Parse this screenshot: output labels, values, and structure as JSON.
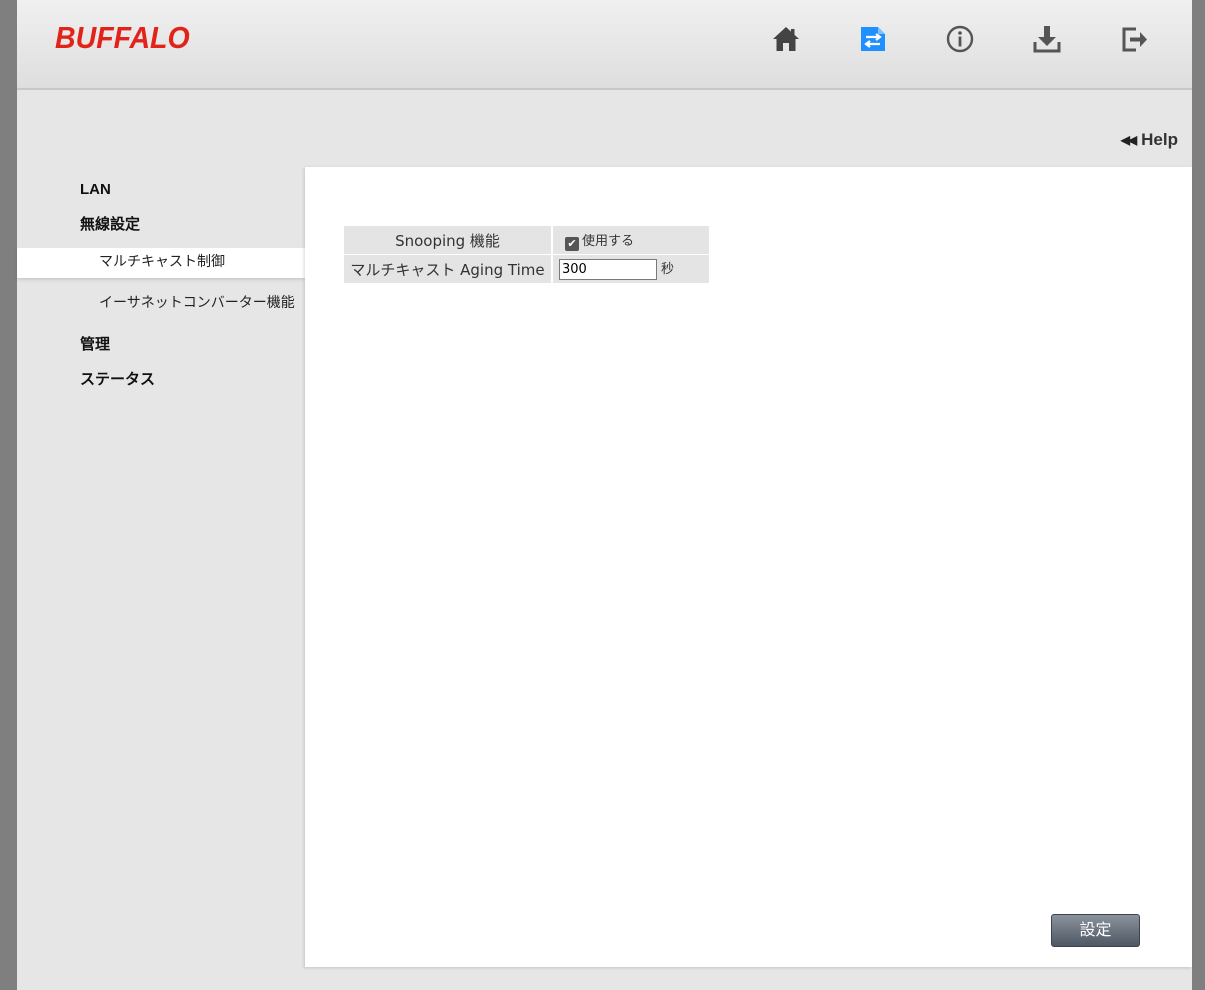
{
  "header": {
    "brand": "BUFFALO",
    "brand_color": "#e2231a",
    "nav_icons": [
      {
        "name": "home-icon"
      },
      {
        "name": "settings-icon",
        "active": true,
        "color": "#1e90ff"
      },
      {
        "name": "info-icon"
      },
      {
        "name": "download-icon"
      },
      {
        "name": "logout-icon"
      }
    ]
  },
  "help": {
    "label": "Help"
  },
  "sidebar": {
    "items": [
      {
        "label": "LAN",
        "level": 1
      },
      {
        "label": "無線設定",
        "level": 1
      },
      {
        "label": "マルチキャスト制御",
        "level": 2,
        "active": true
      },
      {
        "label": "イーサネットコンバーター機能",
        "level": 2
      },
      {
        "label": "管理",
        "level": 1
      },
      {
        "label": "ステータス",
        "level": 1
      }
    ]
  },
  "form": {
    "snooping": {
      "label": "Snooping 機能",
      "checkbox_label": "使用する",
      "checked": true
    },
    "aging_time": {
      "label": "マルチキャスト Aging Time",
      "value": "300",
      "unit": "秒"
    },
    "submit_label": "設定"
  }
}
